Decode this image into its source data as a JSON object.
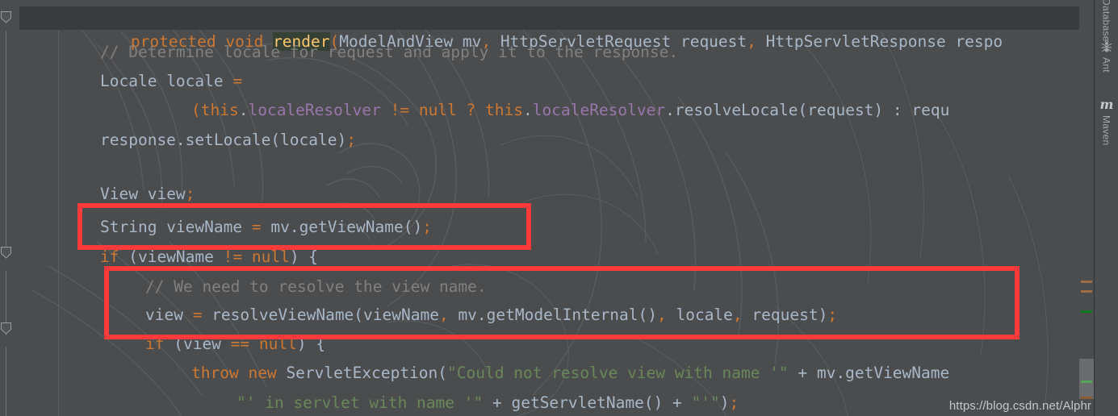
{
  "editor": {
    "caret_line_index": 0,
    "caret_token": "render",
    "lines": [
      {
        "id": "line-signature",
        "text": "protected void render(ModelAndView mv, HttpServletRequest request, HttpServletResponse respo"
      },
      {
        "id": "line-comment-locale",
        "text": "    // Determine locale for request and apply it to the response."
      },
      {
        "id": "line-locale-decl",
        "text": "    Locale locale ="
      },
      {
        "id": "line-locale-ternary",
        "text": "            (this.localeResolver != null ? this.localeResolver.resolveLocale(request) : requ"
      },
      {
        "id": "line-setlocale",
        "text": "    response.setLocale(locale);"
      },
      {
        "id": "line-blank",
        "text": ""
      },
      {
        "id": "line-view-decl",
        "text": "    View view;"
      },
      {
        "id": "line-viewname",
        "text": "    String viewName = mv.getViewName();"
      },
      {
        "id": "line-if-viewname",
        "text": "    if (viewName != null) {"
      },
      {
        "id": "line-comment-resolve",
        "text": "        // We need to resolve the view name."
      },
      {
        "id": "line-resolve-call",
        "text": "        view = resolveViewName(viewName, mv.getModelInternal(), locale, request);"
      },
      {
        "id": "line-if-view-null",
        "text": "        if (view == null) {"
      },
      {
        "id": "line-throw",
        "text": "            throw new ServletException(\"Could not resolve view with name '\" + mv.getViewName"
      },
      {
        "id": "line-throw-cont",
        "text": "                    \"' in servlet with name '\" + getServletName() + \"'\");"
      }
    ]
  },
  "annotations": {
    "boxes": [
      {
        "name": "highlight-box-viewname",
        "label": "String viewName = mv.getViewName();"
      },
      {
        "name": "highlight-box-resolve",
        "label": "view = resolveViewName(viewName, mv.getModelInternal(), locale, request);"
      }
    ],
    "box_color": "#fb3b3b"
  },
  "markers": [
    {
      "name": "marker-warning-1",
      "color": "#9e6b43"
    },
    {
      "name": "marker-warning-2",
      "color": "#9e6b43"
    },
    {
      "name": "marker-change-1",
      "color": "#0d7a20"
    },
    {
      "name": "marker-change-2",
      "color": "#53a557"
    },
    {
      "name": "marker-change-3",
      "color": "#8c5c30"
    }
  ],
  "tool_window_bar": {
    "tabs": [
      {
        "name": "tool-tab-database",
        "label": "Database",
        "icon": "database-icon"
      },
      {
        "name": "tool-tab-ant",
        "label": "Ant",
        "icon": "ant-icon"
      },
      {
        "name": "tool-tab-maven",
        "label": "Maven",
        "icon": "maven-icon"
      }
    ]
  },
  "watermark": {
    "text": "https://blog.csdn.net/Alphr"
  },
  "theme": {
    "background": "#4a4c4e",
    "caret_line_background": "#3a3b3c",
    "default_text": "#a9b7c6",
    "keyword": "#cc7832",
    "comment": "#808080",
    "string": "#6a8759",
    "field": "#9876aa",
    "method": "#ffc66d"
  }
}
